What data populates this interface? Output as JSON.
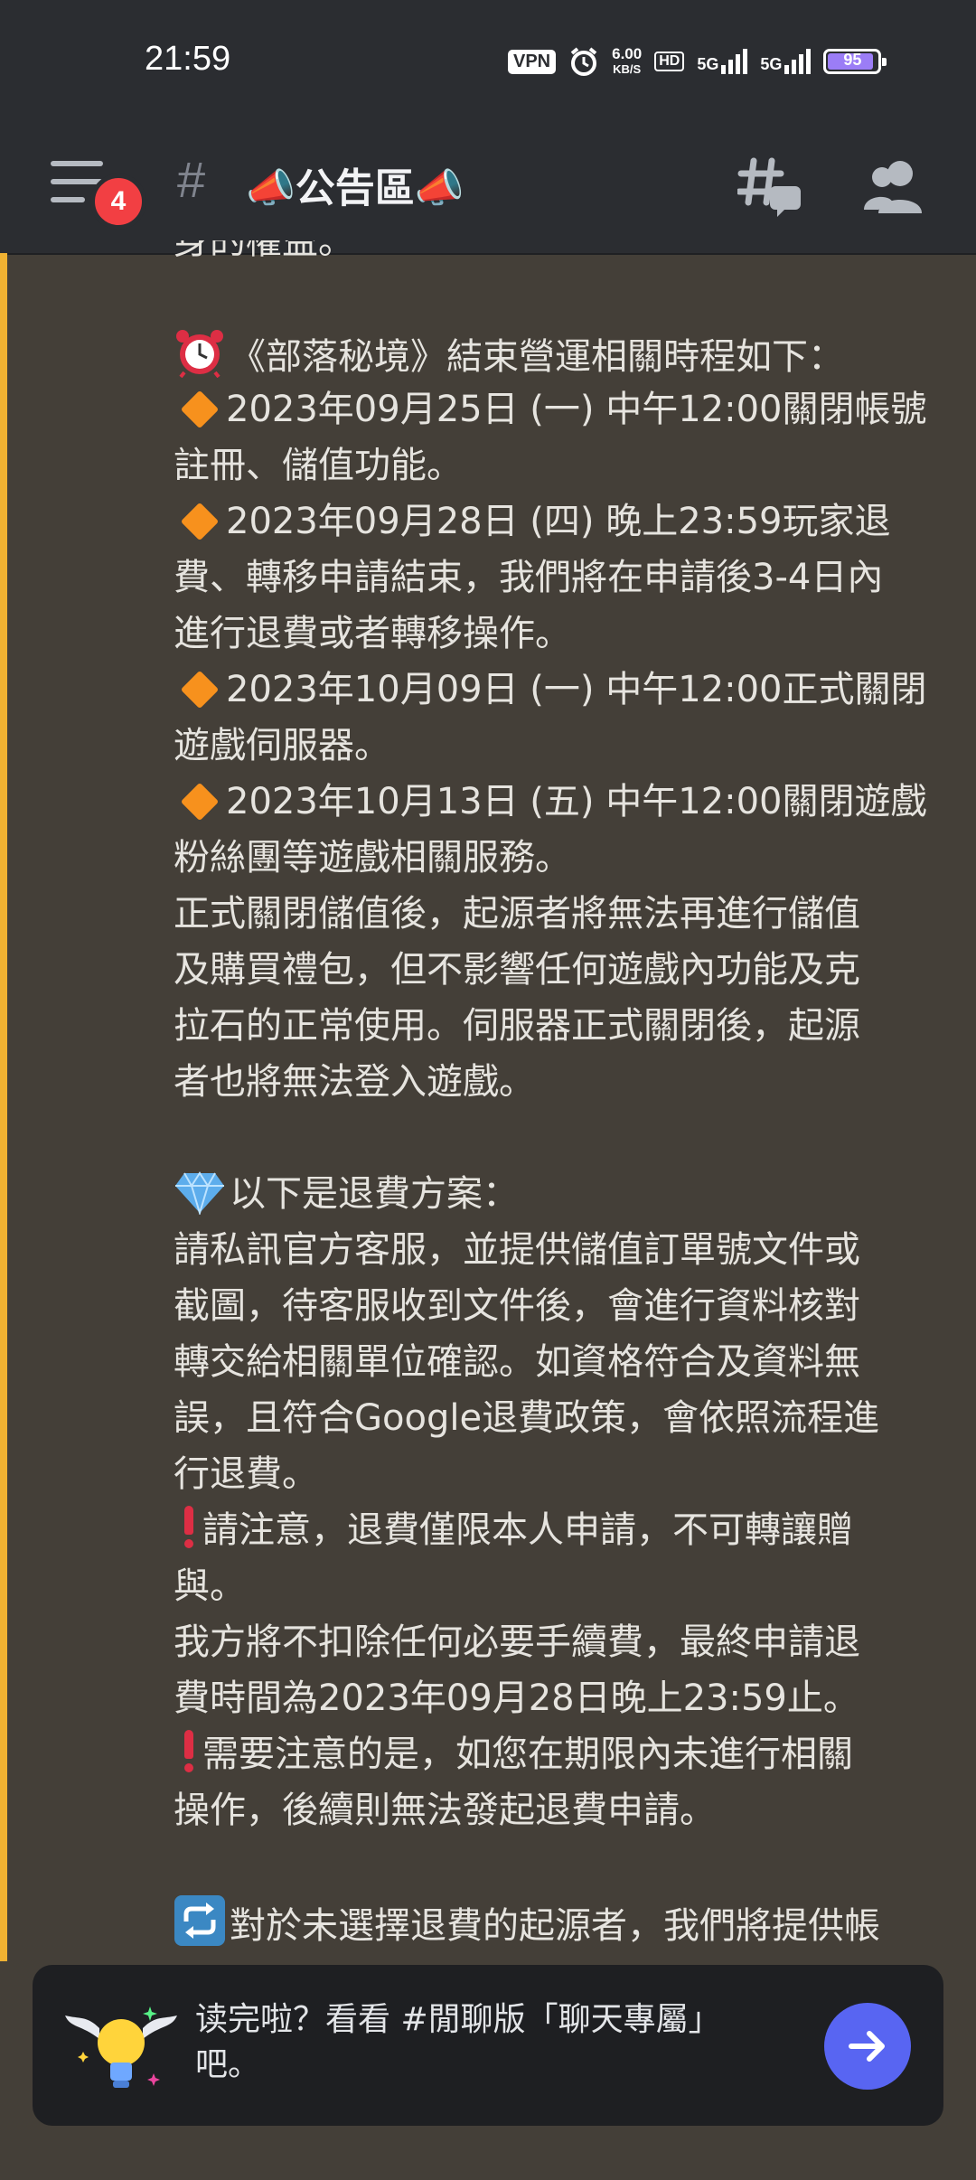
{
  "status_bar": {
    "time": "21:59",
    "vpn": "VPN",
    "speed_value": "6.00",
    "speed_unit": "KB/S",
    "hd": "HD",
    "net1": "5G",
    "net2": "5G",
    "battery": "95"
  },
  "header": {
    "unread_count": "4",
    "channel_name": "📣公告區📣",
    "hash": "#"
  },
  "message": {
    "lines": [
      "身的權益。",
      "",
      "《部落秘境》結束營運相關時程如下：",
      "2023年09月25日 (一) 中午12:00關閉帳號",
      "註冊、儲值功能。",
      "2023年09月28日 (四) 晚上23:59玩家退",
      "費、轉移申請結束，我們將在申請後3-4日內",
      "進行退費或者轉移操作。",
      "2023年10月09日 (一) 中午12:00正式關閉",
      "遊戲伺服器。",
      "2023年10月13日 (五) 中午12:00關閉遊戲",
      "粉絲團等遊戲相關服務。",
      "正式關閉儲值後，起源者將無法再進行儲值",
      "及購買禮包，但不影響任何遊戲內功能及克",
      "拉石的正常使用。伺服器正式關閉後，起源",
      "者也將無法登入遊戲。",
      "",
      "以下是退費方案：",
      "請私訊官方客服，並提供儲值訂單號文件或",
      "截圖，待客服收到文件後，會進行資料核對",
      "轉交給相關單位確認。如資格符合及資料無",
      "誤，且符合Google退費政策，會依照流程進",
      "行退費。",
      "請注意，退費僅限本人申請，不可轉讓贈",
      "與。",
      "我方將不扣除任何必要手續費，最終申請退",
      "費時間為2023年09月28日晚上23:59止。",
      "需要注意的是，如您在期限內未進行相關",
      "操作，後續則無法發起退費申請。",
      "",
      "對於未選擇退費的起源者，我們將提供帳"
    ]
  },
  "prompt": {
    "text": "读完啦？看看 #閒聊版「聊天專屬」吧。"
  },
  "icons": {
    "alarm": "alarm-clock-icon",
    "diamond": "orange-diamond-icon",
    "gem": "gem-icon",
    "exclamation": "red-exclamation-icon",
    "repeat": "repeat-icon",
    "bulb": "winged-lightbulb-icon",
    "send": "arrow-right-icon"
  }
}
